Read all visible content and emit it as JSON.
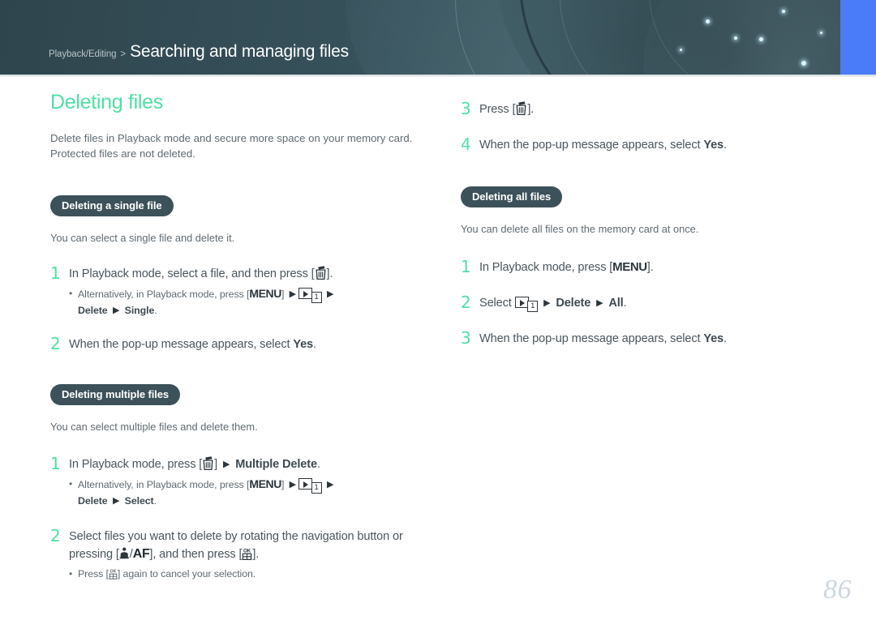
{
  "header": {
    "breadcrumb_parent": "Playback/Editing",
    "breadcrumb_separator": ">",
    "breadcrumb_current": "Searching and managing files",
    "accent_color": "#4a7cfa",
    "background_color": "#3a5159"
  },
  "left_column": {
    "chapter_title": "Deleting files",
    "title_color": "#4fe0a4",
    "lead": "Delete files in Playback mode and secure more space on your memory card. Protected files are not deleted.",
    "sections": [
      {
        "badge": "Deleting a single file",
        "intro": "You can select a single file and delete it.",
        "steps": [
          {
            "num": "1",
            "text_before": "In Playback mode, select a file, and then press [",
            "text_after": "].",
            "bullet_prefix": "Alternatively, in Playback mode, press [",
            "bullet_menu": "MENU",
            "bullet_mid": "] ",
            "bullet_tail_bold_1": "Delete",
            "bullet_tail_bold_2": "Single",
            "bullet_period": "."
          },
          {
            "num": "2",
            "text_plain": "When the pop-up message appears, select ",
            "text_bold": "Yes",
            "text_end": "."
          }
        ]
      },
      {
        "badge": "Deleting multiple files",
        "intro": "You can select multiple files and delete them.",
        "steps": [
          {
            "num": "1",
            "text_before": "In Playback mode, press [",
            "text_mid": "] ",
            "text_bold": "Multiple Delete",
            "text_after": ".",
            "bullet_prefix": "Alternatively, in Playback mode, press [",
            "bullet_menu": "MENU",
            "bullet_tail_bold_1": "Delete",
            "bullet_tail_bold_2": "Select",
            "bullet_period": "."
          },
          {
            "num": "2",
            "text_part_1": "Select files you want to delete by rotating the navigation button or pressing [",
            "text_slash": "/",
            "text_af": "AF",
            "text_part_2": "], and then press [",
            "text_part_3": "].",
            "bullet_prefix": "Press [",
            "bullet_suffix": "] again to cancel your selection."
          }
        ]
      }
    ]
  },
  "right_column": {
    "continued_steps": [
      {
        "num": "3",
        "text_before": "Press [",
        "text_after": "]."
      },
      {
        "num": "4",
        "text_plain": "When the pop-up message appears, select ",
        "text_bold": "Yes",
        "text_end": "."
      }
    ],
    "sections": [
      {
        "badge": "Deleting all files",
        "intro": "You can delete all files on the memory card at once.",
        "steps": [
          {
            "num": "1",
            "text_before": "In Playback mode, press [",
            "menu": "MENU",
            "text_after": "]."
          },
          {
            "num": "2",
            "text_before": "Select ",
            "text_bold_1": "Delete",
            "text_bold_2": "All",
            "text_after": "."
          },
          {
            "num": "3",
            "text_plain": "When the pop-up message appears, select ",
            "text_bold": "Yes",
            "text_end": "."
          }
        ]
      }
    ]
  },
  "footer": {
    "page_number": "86"
  },
  "icons": {
    "trash": "trash-can-icon",
    "menu": "menu-button-icon",
    "playback_tab": "playback-tab-icon",
    "tab_one": "tab-number-one-icon",
    "arrow": "right-arrow-icon",
    "ok_thumbnail": "ok-thumbnail-button-icon",
    "self_timer": "self-timer-af-icon"
  }
}
